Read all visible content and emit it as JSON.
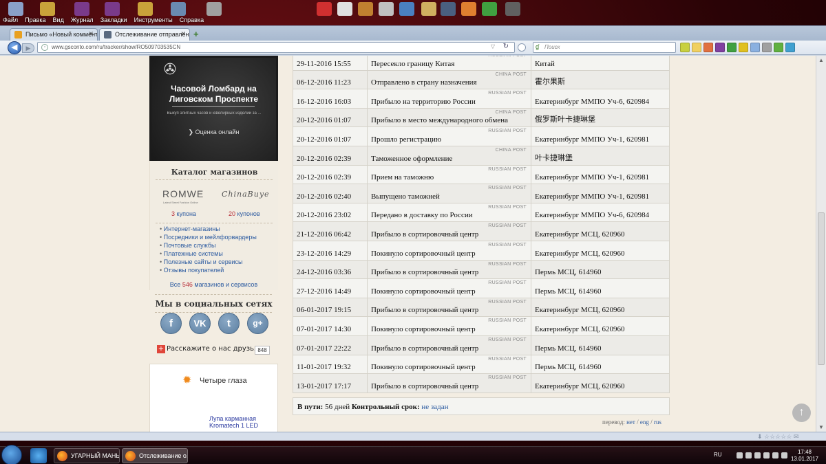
{
  "desktop": {
    "menu": [
      "Файл",
      "Правка",
      "Вид",
      "Журнал",
      "Закладки",
      "Инструменты",
      "Справка"
    ],
    "icon_colors": [
      "#8aa0c8",
      "#c9a23a",
      "#7a3a8a",
      "#7a3a8a",
      "#c9a23a",
      "#6a8ab0",
      "#a0a0a0",
      "#d03030",
      "#e0e0e0",
      "#c08030",
      "#c0c0c0",
      "#4a80c0",
      "#d0b060",
      "#4a6080",
      "#e08030",
      "#40a040",
      "#606060"
    ]
  },
  "browser": {
    "tabs": [
      {
        "title": "Письмо «Новый коммент...",
        "active": false,
        "icon_color": "#e8a020"
      },
      {
        "title": "Отслеживание отправлен...",
        "active": true,
        "icon_color": "#5a6a80"
      }
    ],
    "url": "www.gsconto.com/ru/tracker/show/RO509703535CN",
    "search_placeholder": "Поиск",
    "tool_colors": [
      "#c8d040",
      "#f0d060",
      "#e07040",
      "#8040a0",
      "#40a040",
      "#e0c020",
      "#8ab0e0",
      "#a0a0a0",
      "#60b040",
      "#40a0d0"
    ]
  },
  "sidebar": {
    "promo": {
      "title": "Часовой Ломбард на Лиговском Проспекте",
      "subtitle": "Выкуп элитных часов и ювелирных изделий за ...",
      "button": "Оценка онлайн"
    },
    "catalog": {
      "title": "Каталог магазинов",
      "brands": [
        {
          "name": "ROMWE",
          "sub": "Latest Street Fashion Online",
          "coupons_num": "3",
          "coupons_label": "купона"
        },
        {
          "name": "ChinaBuye",
          "sub": "",
          "coupons_num": "20",
          "coupons_label": "купонов"
        }
      ],
      "links": [
        "Интернет-магазины",
        "Посредники и мейлфорвардеры",
        "Почтовые службы",
        "Платежные системы",
        "Полезные сайты и сервисы",
        "Отзывы покупателей"
      ],
      "all_prefix": "Все",
      "all_count": "546",
      "all_suffix": "магазинов и сервисов"
    },
    "social": {
      "title": "Мы в социальных сетях",
      "networks": [
        {
          "name": "facebook",
          "glyph": "f"
        },
        {
          "name": "vk",
          "glyph": "VK"
        },
        {
          "name": "twitter",
          "glyph": "t"
        },
        {
          "name": "google-plus",
          "glyph": "g+"
        }
      ],
      "share_label": "Расскажите о нас друзьям",
      "share_count": "848"
    },
    "ad": {
      "title": "Четыре глаза",
      "product": "Лупа карманная Kromatech 1 LED"
    }
  },
  "tracking": {
    "rows": [
      {
        "date": "29-11-2016 15:55",
        "status": "Пересекло границу Китая",
        "location": "Китай",
        "carrier": "RUSSIAN POST"
      },
      {
        "date": "06-12-2016 11:23",
        "status": "Отправлено в страну назначения",
        "location": "霍尔果斯",
        "carrier": "CHINA POST"
      },
      {
        "date": "16-12-2016 16:03",
        "status": "Прибыло на территорию России",
        "location": "Екатеринбург ММПО Уч-6, 620984",
        "carrier": "RUSSIAN POST"
      },
      {
        "date": "20-12-2016 01:07",
        "status": "Прибыло в место международного обмена",
        "location": "俄罗斯叶卡捷琳堡",
        "carrier": "CHINA POST"
      },
      {
        "date": "20-12-2016 01:07",
        "status": "Прошло регистрацию",
        "location": "Екатеринбург ММПО Уч-1, 620981",
        "carrier": "RUSSIAN POST"
      },
      {
        "date": "20-12-2016 02:39",
        "status": "Таможенное оформление",
        "location": "叶卡捷琳堡",
        "carrier": "CHINA POST"
      },
      {
        "date": "20-12-2016 02:39",
        "status": "Прием на таможню",
        "location": "Екатеринбург ММПО Уч-1, 620981",
        "carrier": "RUSSIAN POST"
      },
      {
        "date": "20-12-2016 02:40",
        "status": "Выпущено таможней",
        "location": "Екатеринбург ММПО Уч-1, 620981",
        "carrier": "RUSSIAN POST"
      },
      {
        "date": "20-12-2016 23:02",
        "status": "Передано в доставку по России",
        "location": "Екатеринбург ММПО Уч-6, 620984",
        "carrier": "RUSSIAN POST"
      },
      {
        "date": "21-12-2016 06:42",
        "status": "Прибыло в сортировочный центр",
        "location": "Екатеринбург МСЦ, 620960",
        "carrier": "RUSSIAN POST"
      },
      {
        "date": "23-12-2016 14:29",
        "status": "Покинуло сортировочный центр",
        "location": "Екатеринбург МСЦ, 620960",
        "carrier": "RUSSIAN POST"
      },
      {
        "date": "24-12-2016 03:36",
        "status": "Прибыло в сортировочный центр",
        "location": "Пермь МСЦ, 614960",
        "carrier": "RUSSIAN POST"
      },
      {
        "date": "27-12-2016 14:49",
        "status": "Покинуло сортировочный центр",
        "location": "Пермь МСЦ, 614960",
        "carrier": "RUSSIAN POST"
      },
      {
        "date": "06-01-2017 19:15",
        "status": "Прибыло в сортировочный центр",
        "location": "Екатеринбург МСЦ, 620960",
        "carrier": "RUSSIAN POST"
      },
      {
        "date": "07-01-2017 14:30",
        "status": "Покинуло сортировочный центр",
        "location": "Екатеринбург МСЦ, 620960",
        "carrier": "RUSSIAN POST"
      },
      {
        "date": "07-01-2017 22:22",
        "status": "Прибыло в сортировочный центр",
        "location": "Пермь МСЦ, 614960",
        "carrier": "RUSSIAN POST"
      },
      {
        "date": "11-01-2017 19:32",
        "status": "Покинуло сортировочный центр",
        "location": "Пермь МСЦ, 614960",
        "carrier": "RUSSIAN POST"
      },
      {
        "date": "13-01-2017 17:17",
        "status": "Прибыло в сортировочный центр",
        "location": "Екатеринбург МСЦ, 620960",
        "carrier": "RUSSIAN POST"
      }
    ],
    "summary": {
      "in_transit_label": "В пути:",
      "in_transit_value": "56 дней",
      "deadline_label": "Контрольный срок:",
      "deadline_value": "не задан"
    },
    "translate": {
      "label": "перевод:",
      "options": [
        "нет",
        "eng",
        "rus"
      ]
    }
  },
  "taskbar": {
    "tasks": [
      {
        "title": "УГАРНЫЙ МАНЬ...",
        "active": false
      },
      {
        "title": "Отслеживание о...",
        "active": true
      }
    ],
    "lang": "RU",
    "time": "17:48",
    "date": "13.01.2017"
  }
}
